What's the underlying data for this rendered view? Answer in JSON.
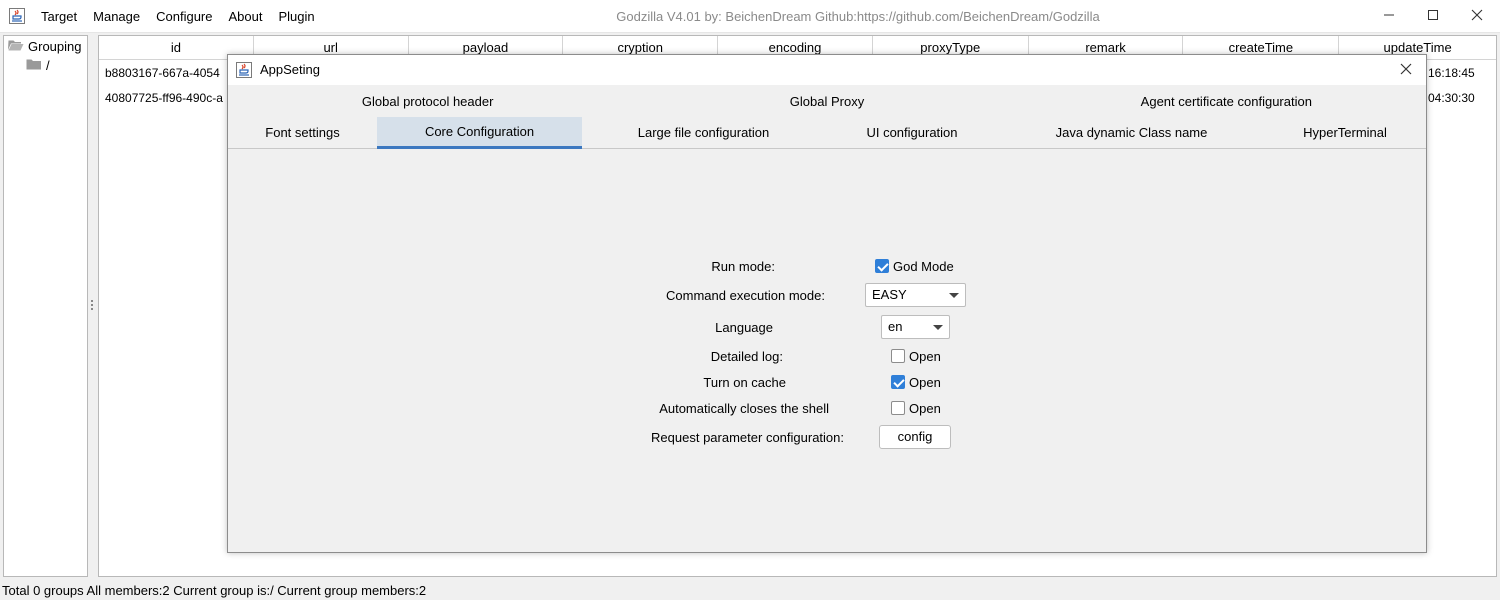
{
  "window": {
    "title": "Godzilla V4.01 by: BeichenDream Github:https://github.com/BeichenDream/Godzilla",
    "menu": [
      "Target",
      "Manage",
      "Configure",
      "About",
      "Plugin"
    ]
  },
  "tree": {
    "root_label": "Grouping",
    "child_label": "/"
  },
  "table": {
    "columns": [
      "id",
      "url",
      "payload",
      "cryption",
      "encoding",
      "proxyType",
      "remark",
      "createTime",
      "updateTime"
    ],
    "rows": [
      {
        "id": "b8803167-667a-4054",
        "updateTime": "16:18:45"
      },
      {
        "id": "40807725-ff96-490c-a",
        "updateTime": "04:30:30"
      }
    ]
  },
  "status": {
    "text": "Total 0 groups All members:2 Current group is:/ Current group members:2"
  },
  "dialog": {
    "title": "AppSeting",
    "tabs_row1": [
      "Global protocol header",
      "Global Proxy",
      "Agent certificate configuration"
    ],
    "tabs_row2": [
      "Font settings",
      "Core Configuration",
      "Large file configuration",
      "UI configuration",
      "Java dynamic Class name",
      "HyperTerminal"
    ],
    "active_tab": "Core Configuration",
    "form": {
      "run_mode_label": "Run mode:",
      "run_mode_check": "God Mode",
      "run_mode_checked": true,
      "cmd_mode_label": "Command execution mode:",
      "cmd_mode_value": "EASY",
      "language_label": "Language",
      "language_value": "en",
      "detailed_log_label": "Detailed log:",
      "detailed_log_check": "Open",
      "detailed_log_checked": false,
      "cache_label": "Turn on cache",
      "cache_check": "Open",
      "cache_checked": true,
      "auto_close_label": "Automatically closes the shell",
      "auto_close_check": "Open",
      "auto_close_checked": false,
      "request_param_label": "Request parameter configuration:",
      "config_button": "config"
    }
  },
  "colors": {
    "accent": "#2f7fd8",
    "active_tab_bg": "#d6e0ea",
    "active_tab_underline": "#3c78c0"
  },
  "icons": [
    "java-cup-icon",
    "minimize-icon",
    "maximize-icon",
    "close-icon",
    "folder-open-icon",
    "folder-icon",
    "chevron-down-icon"
  ]
}
